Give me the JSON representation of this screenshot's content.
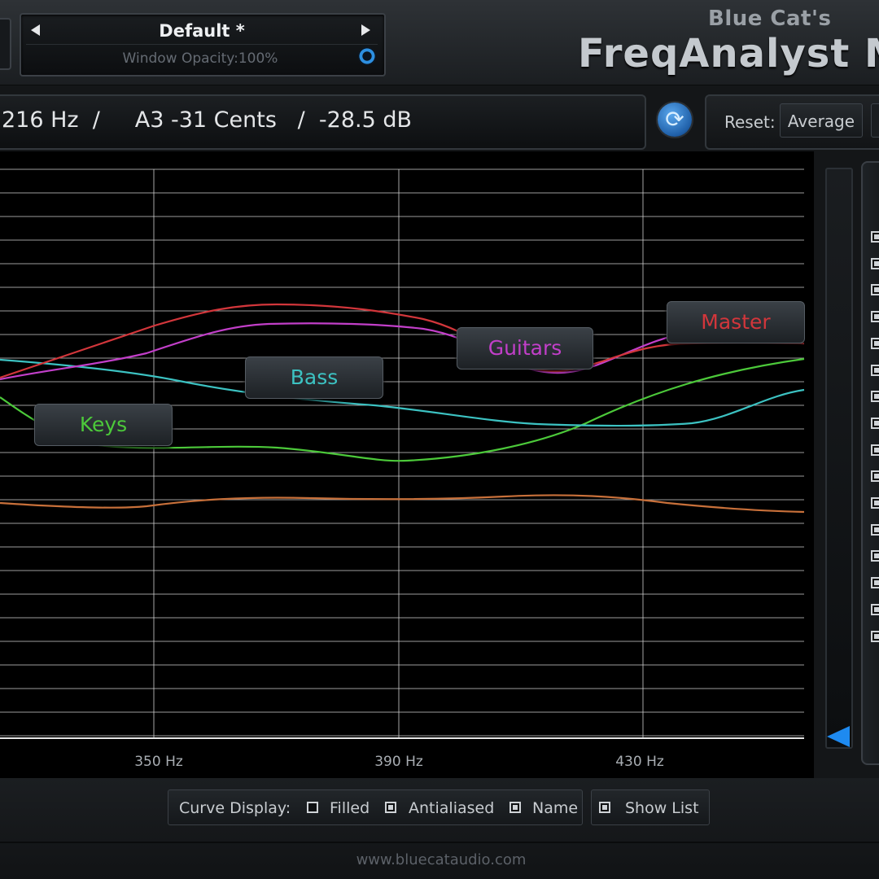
{
  "preset": {
    "name": "Default *",
    "window_opacity": "Window Opacity:100%"
  },
  "brand": {
    "vendor": "Blue Cat's",
    "product": "FreqAnalyst M"
  },
  "readout": {
    "text": "216 Hz  /     A3 -31 Cents   /  -28.5 dB"
  },
  "reset": {
    "label": "Reset:",
    "average_label": "Average"
  },
  "graph": {
    "x_ticks": [
      "350 Hz",
      "390 Hz",
      "430 Hz"
    ],
    "curve_labels": {
      "keys": "Keys",
      "bass": "Bass",
      "guitars": "Guitars",
      "master": "Master"
    },
    "colors": {
      "keys": "#4cc93a",
      "bass": "#3cc2c2",
      "guitars": "#c23fc9",
      "master": "#d2363b",
      "orange": "#c8703a",
      "grid": "#d0d0d0",
      "accent": "#1e8af0"
    }
  },
  "curve_display": {
    "label": "Curve Display:",
    "filled": {
      "label": "Filled",
      "checked": false
    },
    "antialiased": {
      "label": "Antialiased",
      "checked": true
    },
    "name": {
      "label": "Name",
      "checked": true
    },
    "show_list": {
      "label": "Show List",
      "checked": true
    }
  },
  "footer": {
    "website": "www.bluecataudio.com"
  }
}
